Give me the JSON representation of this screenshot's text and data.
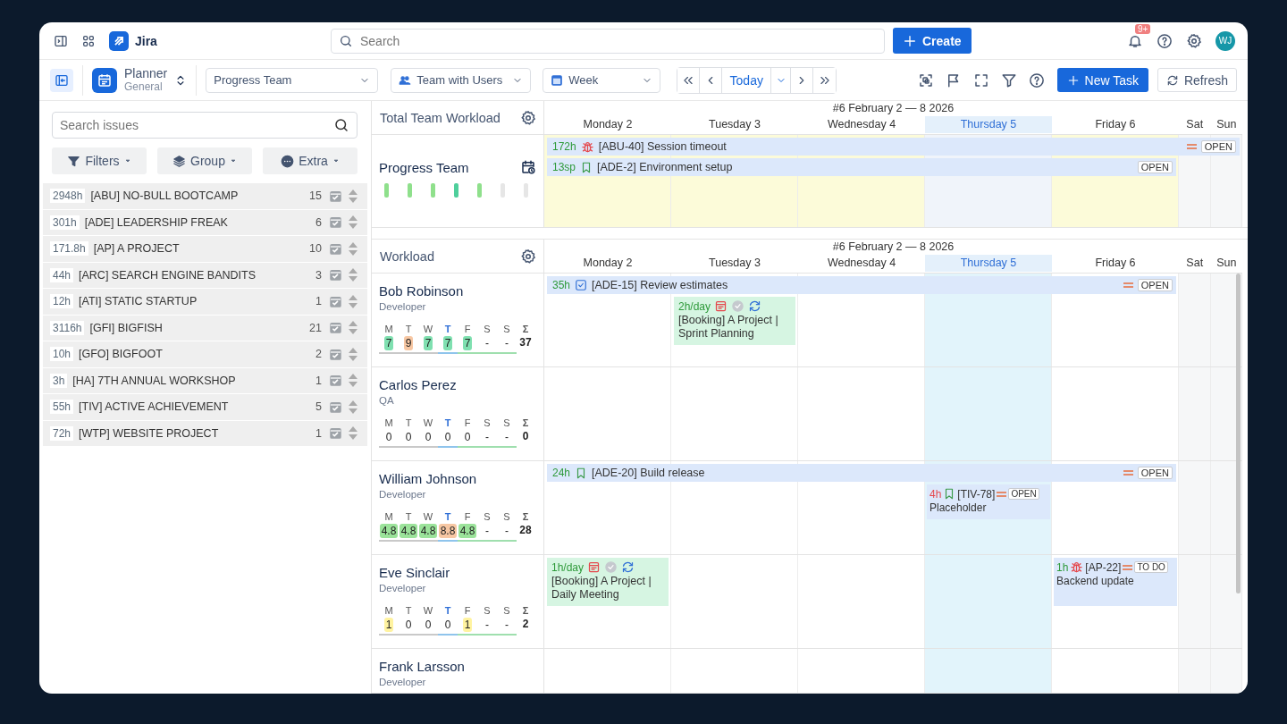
{
  "topbar": {
    "app_name": "Jira",
    "search": {
      "placeholder": "Search"
    },
    "create_button": "Create",
    "notification_badge": "9+",
    "avatar": "WJ"
  },
  "toolbar": {
    "planner_title": "Planner",
    "planner_subtitle": "General",
    "team_select": "Progress Team",
    "view_select": "Team with Users",
    "range_select": "Week",
    "today_button": "Today",
    "new_task_button": "New Task",
    "refresh_button": "Refresh"
  },
  "sidebar": {
    "search": {
      "placeholder": "Search issues"
    },
    "buttons": [
      {
        "label": "Filters",
        "kind": "filter"
      },
      {
        "label": "Group",
        "kind": "group"
      },
      {
        "label": "Extra",
        "kind": "extra"
      }
    ],
    "projects": [
      {
        "hours": "2948h",
        "name": "[ABU] NO-BULL BOOTCAMP",
        "count": "15"
      },
      {
        "hours": "301h",
        "name": "[ADE] LEADERSHIP FREAK",
        "count": "6"
      },
      {
        "hours": "171.8h",
        "name": "[AP] A PROJECT",
        "count": "10"
      },
      {
        "hours": "44h",
        "name": "[ARC] SEARCH ENGINE BANDITS",
        "count": "3"
      },
      {
        "hours": "12h",
        "name": "[ATI] STATIC STARTUP",
        "count": "1"
      },
      {
        "hours": "3116h",
        "name": "[GFI] BIGFISH",
        "count": "21"
      },
      {
        "hours": "10h",
        "name": "[GFO] BIGFOOT",
        "count": "2"
      },
      {
        "hours": "3h",
        "name": "[HA] 7TH ANNUAL WORKSHOP",
        "count": "1"
      },
      {
        "hours": "55h",
        "name": "[TIV] ACTIVE ACHIEVEMENT",
        "count": "5"
      },
      {
        "hours": "72h",
        "name": "[WTP] WEBSITE PROJECT",
        "count": "1"
      }
    ]
  },
  "team_workload": {
    "title": "Total Team Workload",
    "week": "#6 February 2 — 8 2026",
    "days": [
      {
        "name": "Monday 2",
        "today": false,
        "kind": "weekday"
      },
      {
        "name": "Tuesday 3",
        "today": false,
        "kind": "weekday"
      },
      {
        "name": "Wednesday 4",
        "today": false,
        "kind": "weekday"
      },
      {
        "name": "Thursday 5",
        "today": true,
        "kind": "weekday"
      },
      {
        "name": "Friday 6",
        "today": false,
        "kind": "weekday"
      },
      {
        "name": "Sat",
        "today": false,
        "kind": "weekend"
      },
      {
        "name": "Sun",
        "today": false,
        "kind": "weekend"
      }
    ],
    "team": {
      "name": "Progress Team",
      "bars": [
        {
          "color": "#8fe08c"
        },
        {
          "color": "#8fe08c"
        },
        {
          "color": "#8fe08c"
        },
        {
          "color": "#4fcf9c"
        },
        {
          "color": "#8fe08c"
        },
        {
          "color": "#e6e6e6"
        },
        {
          "color": "#e6e6e6"
        }
      ]
    },
    "cells": [
      {
        "highlighted": true
      },
      {
        "highlighted": true
      },
      {
        "highlighted": true
      },
      {
        "highlighted": false
      },
      {
        "highlighted": true
      },
      {
        "highlighted": false
      },
      {
        "highlighted": false
      }
    ],
    "tasks": [
      {
        "kind": "bar",
        "start": {
          "kind": "mon"
        },
        "end": {
          "kind": "sun"
        },
        "amount": "172h",
        "amount_alert": false,
        "icon": {
          "kind": "bug"
        },
        "title": "[ABU-40] Session timeout",
        "priority": {
          "kind": "medium"
        },
        "status": "OPEN"
      },
      {
        "kind": "bar",
        "start": {
          "kind": "mon"
        },
        "end": {
          "kind": "fri"
        },
        "amount": "13sp",
        "amount_alert": false,
        "icon": {
          "kind": "story"
        },
        "title": "[ADE-2] Environment setup",
        "status": "OPEN"
      }
    ]
  },
  "workload": {
    "title": "Workload",
    "week": "#6 February 2 — 8 2026",
    "days": [
      {
        "name": "Monday 2",
        "today": false,
        "kind": "weekday"
      },
      {
        "name": "Tuesday 3",
        "today": false,
        "kind": "weekday"
      },
      {
        "name": "Wednesday 4",
        "today": false,
        "kind": "weekday"
      },
      {
        "name": "Thursday 5",
        "today": true,
        "kind": "weekday"
      },
      {
        "name": "Friday 6",
        "today": false,
        "kind": "weekday"
      },
      {
        "name": "Sat",
        "today": false,
        "kind": "weekend"
      },
      {
        "name": "Sun",
        "today": false,
        "kind": "weekend"
      }
    ],
    "people": [
      {
        "name": "Bob Robinson",
        "role": "Developer",
        "sum_label": "Σ",
        "total": "37",
        "summary": [
          {
            "label": "M",
            "value": "7",
            "color": "#7fe0b0"
          },
          {
            "label": "T",
            "value": "9",
            "color": "#f7c7a3"
          },
          {
            "label": "W",
            "value": "7",
            "color": "#7fe0b0"
          },
          {
            "label": "T",
            "value": "7",
            "color": "#7fe0b0"
          },
          {
            "label": "F",
            "value": "7",
            "color": "#7fe0b0"
          },
          {
            "label": "S",
            "value": "-"
          },
          {
            "label": "S",
            "value": "-"
          }
        ],
        "events": [
          {
            "kind": "bar",
            "start": {
              "kind": "mon"
            },
            "end": {
              "kind": "fri"
            },
            "amount": "35h",
            "amount_alert": false,
            "icon": {
              "kind": "task"
            },
            "title": "[ADE-15] Review estimates",
            "priority": {
              "kind": "medium"
            },
            "status": "OPEN"
          },
          {
            "kind": "booking",
            "start": {
              "kind": "tue"
            },
            "end": {
              "kind": "tue"
            },
            "amount": "2h/day",
            "title": "[Booking] A Project | Sprint Planning"
          }
        ]
      },
      {
        "name": "Carlos Perez",
        "role": "QA",
        "sum_label": "Σ",
        "total": "0",
        "summary": [
          {
            "label": "M",
            "value": "0"
          },
          {
            "label": "T",
            "value": "0"
          },
          {
            "label": "W",
            "value": "0"
          },
          {
            "label": "T",
            "value": "0"
          },
          {
            "label": "F",
            "value": "0"
          },
          {
            "label": "S",
            "value": "-"
          },
          {
            "label": "S",
            "value": "-"
          }
        ]
      },
      {
        "name": "William Johnson",
        "role": "Developer",
        "sum_label": "Σ",
        "total": "28",
        "summary": [
          {
            "label": "M",
            "value": "4.8",
            "color": "#9be39a"
          },
          {
            "label": "T",
            "value": "4.8",
            "color": "#9be39a"
          },
          {
            "label": "W",
            "value": "4.8",
            "color": "#9be39a"
          },
          {
            "label": "T",
            "value": "8.8",
            "color": "#f7c7a3"
          },
          {
            "label": "F",
            "value": "4.8",
            "color": "#9be39a"
          },
          {
            "label": "S",
            "value": "-"
          },
          {
            "label": "S",
            "value": "-"
          }
        ],
        "events": [
          {
            "kind": "bar",
            "start": {
              "kind": "mon"
            },
            "end": {
              "kind": "fri"
            },
            "amount": "24h",
            "amount_alert": false,
            "icon": {
              "kind": "story"
            },
            "title": "[ADE-20] Build release",
            "priority": {
              "kind": "medium"
            },
            "status": "OPEN"
          },
          {
            "kind": "card",
            "start": {
              "kind": "thu"
            },
            "end": {
              "kind": "thu"
            },
            "amount": "4h",
            "amount_alert": true,
            "icon": {
              "kind": "story"
            },
            "key": "[TIV-78]",
            "priority": {
              "kind": "medium"
            },
            "status": "OPEN",
            "title": "Placeholder"
          }
        ]
      },
      {
        "name": "Eve Sinclair",
        "role": "Developer",
        "sum_label": "Σ",
        "total": "2",
        "summary": [
          {
            "label": "M",
            "value": "1",
            "color": "#fff3a0"
          },
          {
            "label": "T",
            "value": "0"
          },
          {
            "label": "W",
            "value": "0"
          },
          {
            "label": "T",
            "value": "0"
          },
          {
            "label": "F",
            "value": "1",
            "color": "#fff3a0"
          },
          {
            "label": "S",
            "value": "-"
          },
          {
            "label": "S",
            "value": "-"
          }
        ],
        "events": [
          {
            "kind": "booking",
            "start": {
              "kind": "mon"
            },
            "end": {
              "kind": "mon"
            },
            "amount": "1h/day",
            "title": "[Booking] A Project | Daily Meeting"
          },
          {
            "kind": "card",
            "start": {
              "kind": "fri"
            },
            "end": {
              "kind": "fri"
            },
            "amount": "1h",
            "amount_alert": false,
            "icon": {
              "kind": "bug"
            },
            "key": "[AP-22]",
            "priority": {
              "kind": "medium"
            },
            "status": "TO DO",
            "title": "Backend update"
          }
        ]
      },
      {
        "name": "Frank Larsson",
        "role": "Developer"
      }
    ]
  }
}
